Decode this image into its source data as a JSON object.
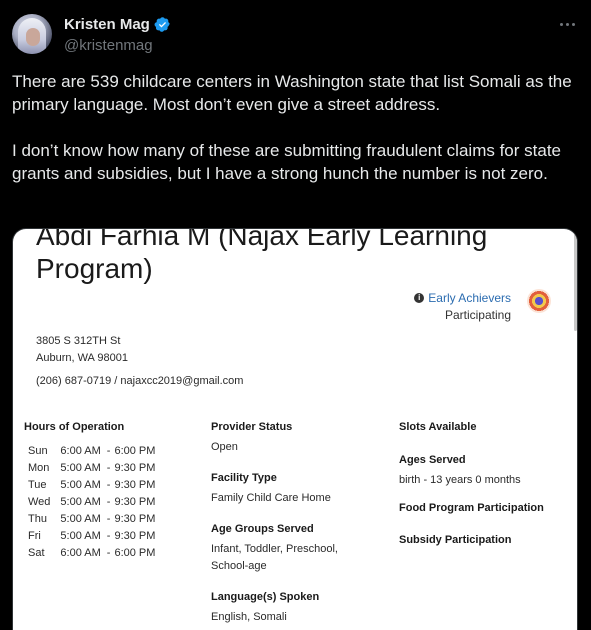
{
  "author": {
    "display_name": "Kristen Mag",
    "handle": "@kristenmag"
  },
  "icons": {
    "verified": "verified-badge-icon",
    "more": "more-options-icon",
    "info": "info-icon",
    "early_achievers": "early-achievers-badge-icon"
  },
  "colors": {
    "background": "#000000",
    "text": "#e7e9ea",
    "muted": "#71767b",
    "verified": "#1d9bf0",
    "link": "#2b6cb0"
  },
  "tweet": {
    "paragraph1": "There are 539 childcare centers in Washington state that list Somali as the primary language. Most don’t even give a street address.",
    "paragraph2": "I don’t know how many of these are submitting fraudulent claims for state grants and subsidies, but I have a strong hunch the number is not zero."
  },
  "listing": {
    "title": "Abdi Farhia M (Najax Early Learning Program)",
    "early_achievers": {
      "link": "Early Achievers",
      "status": "Participating"
    },
    "address_line1": "3805 S 312TH St",
    "address_line2": "Auburn, WA 98001",
    "contact": "(206) 687-0719 / najaxcc2019@gmail.com",
    "hours": {
      "heading": "Hours of Operation",
      "rows": [
        {
          "day": "Sun",
          "open": "6:00 AM",
          "close": "6:00 PM"
        },
        {
          "day": "Mon",
          "open": "5:00 AM",
          "close": "9:30 PM"
        },
        {
          "day": "Tue",
          "open": "5:00 AM",
          "close": "9:30 PM"
        },
        {
          "day": "Wed",
          "open": "5:00 AM",
          "close": "9:30 PM"
        },
        {
          "day": "Thu",
          "open": "5:00 AM",
          "close": "9:30 PM"
        },
        {
          "day": "Fri",
          "open": "5:00 AM",
          "close": "9:30 PM"
        },
        {
          "day": "Sat",
          "open": "6:00 AM",
          "close": "6:00 PM"
        }
      ]
    },
    "provider_status": {
      "label": "Provider Status",
      "value": "Open"
    },
    "facility_type": {
      "label": "Facility Type",
      "value": "Family Child Care Home"
    },
    "age_groups": {
      "label": "Age Groups Served",
      "value": "Infant, Toddler, Preschool, School-age"
    },
    "languages": {
      "label": "Language(s) Spoken",
      "value": "English, Somali"
    },
    "slots": {
      "label": "Slots Available"
    },
    "ages_served": {
      "label": "Ages Served",
      "value": "birth - 13 years 0 months"
    },
    "food_program": {
      "label": "Food Program Participation"
    },
    "subsidy": {
      "label": "Subsidy Participation"
    }
  }
}
